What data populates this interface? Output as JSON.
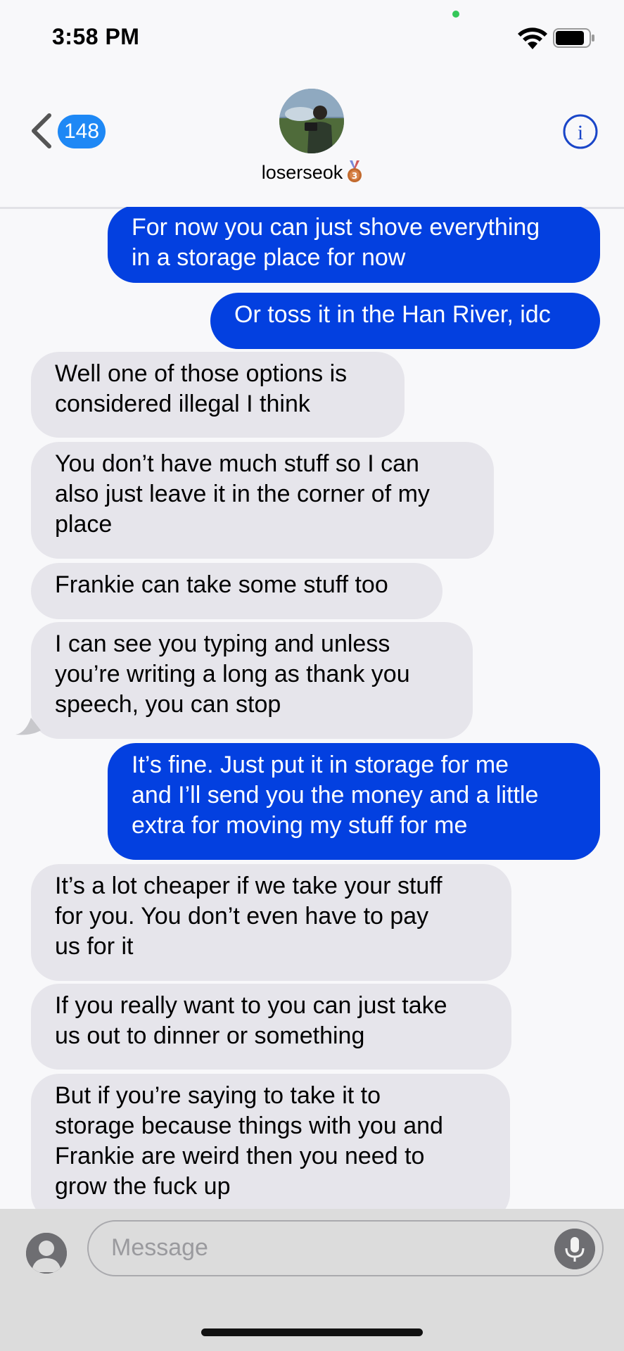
{
  "status_bar": {
    "time": "3:58 PM"
  },
  "header": {
    "unread_count": "148",
    "contact_name": "loserseok"
  },
  "messages": [
    {
      "side": "out",
      "lines": [
        "For now you can just shove everything",
        "in a storage place for now"
      ]
    },
    {
      "side": "out",
      "lines": [
        "Or toss it in the Han River, idc"
      ]
    },
    {
      "side": "in",
      "lines": [
        "Well one of those options is",
        "considered illegal I think"
      ]
    },
    {
      "side": "in",
      "lines": [
        "You don’t have much stuff so I can",
        "also just leave it in the corner of my",
        "place"
      ]
    },
    {
      "side": "in",
      "lines": [
        "Frankie can take some stuff too"
      ]
    },
    {
      "side": "in",
      "lines": [
        "I can see you typing and unless",
        "you’re writing a long as thank you",
        "speech, you can stop"
      ]
    },
    {
      "side": "out",
      "lines": [
        "It’s fine. Just put it in storage for me",
        "and I’ll send you the money and a little",
        "extra for moving my stuff for me"
      ]
    },
    {
      "side": "in",
      "lines": [
        "It’s a lot cheaper if we take your stuff",
        "for you. You don’t even have to pay",
        "us for it"
      ]
    },
    {
      "side": "in",
      "lines": [
        "If you really want to you can just take",
        "us out to dinner or something"
      ]
    },
    {
      "side": "in",
      "lines": [
        "But if you’re saying to take it to",
        "storage because things with you and",
        "Frankie are weird then you need to",
        "grow the fuck up"
      ]
    }
  ],
  "composer": {
    "placeholder": "Message"
  },
  "icons": [
    "back-chevron-icon",
    "info-icon",
    "wifi-icon",
    "battery-icon",
    "medal-icon",
    "contact-photo-icon",
    "microphone-icon"
  ],
  "colors": {
    "outgoing": "#0340e0",
    "incoming": "#e6e5eb",
    "badge": "#1e88f5",
    "accent": "#1a46c8"
  }
}
